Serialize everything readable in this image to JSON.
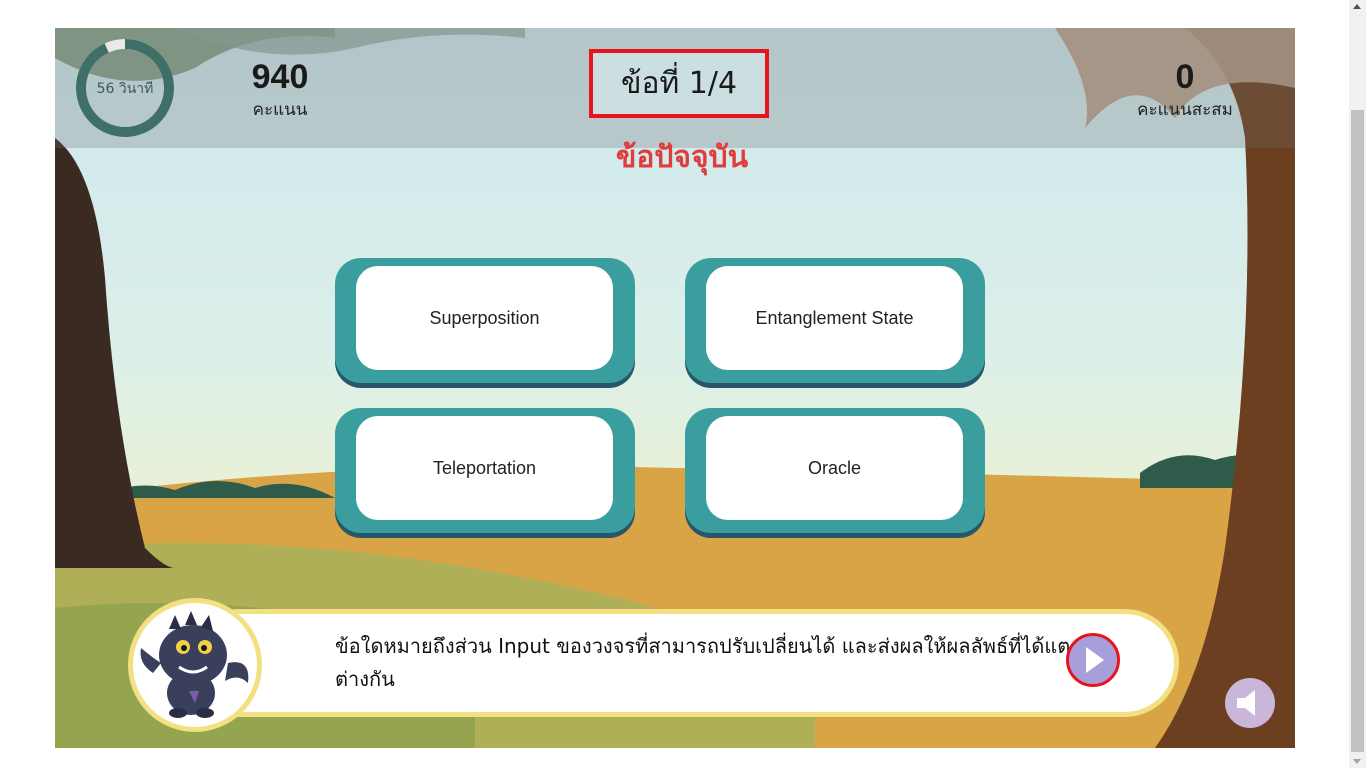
{
  "hud": {
    "timer_text": "56 วินาที",
    "timer_fraction": 0.93,
    "score_value": "940",
    "score_label": "คะแนน",
    "total_value": "0",
    "total_label": "คะแนนสะสม"
  },
  "question": {
    "number_label": "ข้อที่ 1/4",
    "type_label": "ข้อปัจจุบัน",
    "text": "ข้อใดหมายถึงส่วน Input ของวงจรที่สามารถปรับเปลี่ยนได้ และส่งผลให้ผลลัพธ์ที่ได้แตกต่างกัน"
  },
  "choices": [
    "Superposition",
    "Entanglement State",
    "Teleportation",
    "Oracle"
  ],
  "colors": {
    "choice_border": "#3a9e9e",
    "highlight_red": "#e8141c",
    "question_type_red": "#e13b3b",
    "question_bar_border": "#f3e082",
    "play_button": "#a79fd9"
  }
}
